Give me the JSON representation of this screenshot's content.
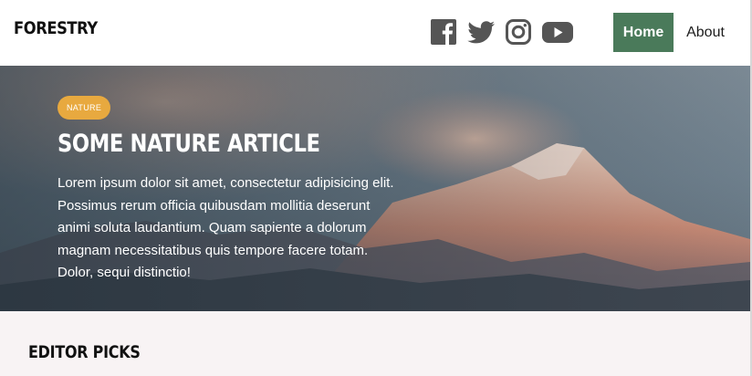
{
  "header": {
    "brand": "FORESTRY",
    "socials": [
      {
        "icon": "facebook-icon"
      },
      {
        "icon": "twitter-icon"
      },
      {
        "icon": "instagram-icon"
      },
      {
        "icon": "youtube-icon"
      }
    ],
    "nav": [
      {
        "label": "Home",
        "active": true
      },
      {
        "label": "About",
        "active": false
      }
    ]
  },
  "hero": {
    "badge": "NATURE",
    "title": "SOME NATURE ARTICLE",
    "text": "Lorem ipsum dolor sit amet, consectetur adipisicing elit. Possimus rerum officia quibusdam mollitia deserunt animi soluta laudantium. Quam sapiente a dolorum magnam necessitatibus quis tempore facere totam. Dolor, sequi distinctio!"
  },
  "section": {
    "title": "EDITOR PICKS"
  },
  "colors": {
    "nav_active_bg": "#4a7a5a",
    "badge_bg": "#e8a93f",
    "icon_color": "#555555",
    "section_bg": "#f8f3f4"
  }
}
